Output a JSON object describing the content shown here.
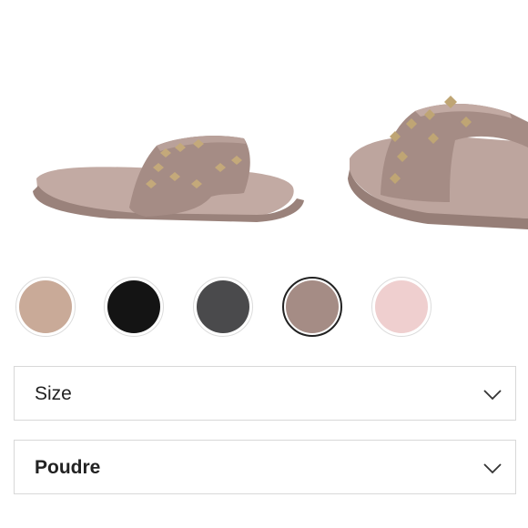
{
  "colors": {
    "selected_ring": "#222222",
    "border": "#d8d8d8",
    "sandal": "#a79089"
  },
  "gallery": {
    "images": [
      {
        "icon": "sandal-side-view-image"
      },
      {
        "icon": "sandal-angled-view-image"
      }
    ]
  },
  "swatches": [
    {
      "name": "nude",
      "color": "#c9aa98",
      "selected": false
    },
    {
      "name": "black",
      "color": "#141414",
      "selected": false
    },
    {
      "name": "charcoal",
      "color": "#4a4a4c",
      "selected": false
    },
    {
      "name": "poudre",
      "color": "#a58c85",
      "selected": true
    },
    {
      "name": "light-pink",
      "color": "#efcfcf",
      "selected": false
    }
  ],
  "size_select": {
    "label": "Size",
    "icon": "chevron-down-icon"
  },
  "color_select": {
    "label": "Poudre",
    "icon": "chevron-down-icon"
  }
}
